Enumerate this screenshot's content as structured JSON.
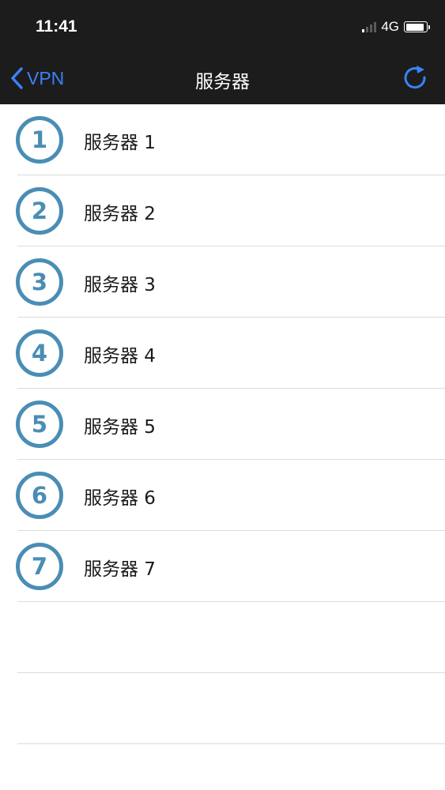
{
  "status_bar": {
    "time": "11:41",
    "network": "4G",
    "icons": [
      "signal-icon",
      "battery-icon"
    ]
  },
  "nav": {
    "back_label": "VPN",
    "title": "服务器",
    "back_icon": "chevron-left-icon",
    "refresh_icon": "refresh-icon",
    "accent_color": "#3a82f7"
  },
  "servers": [
    {
      "number": "1",
      "label": "服务器 1"
    },
    {
      "number": "2",
      "label": "服务器 2"
    },
    {
      "number": "3",
      "label": "服务器 3"
    },
    {
      "number": "4",
      "label": "服务器 4"
    },
    {
      "number": "5",
      "label": "服务器 5"
    },
    {
      "number": "6",
      "label": "服务器 6"
    },
    {
      "number": "7",
      "label": "服务器 7"
    }
  ],
  "badge_color": "#4a8db5"
}
